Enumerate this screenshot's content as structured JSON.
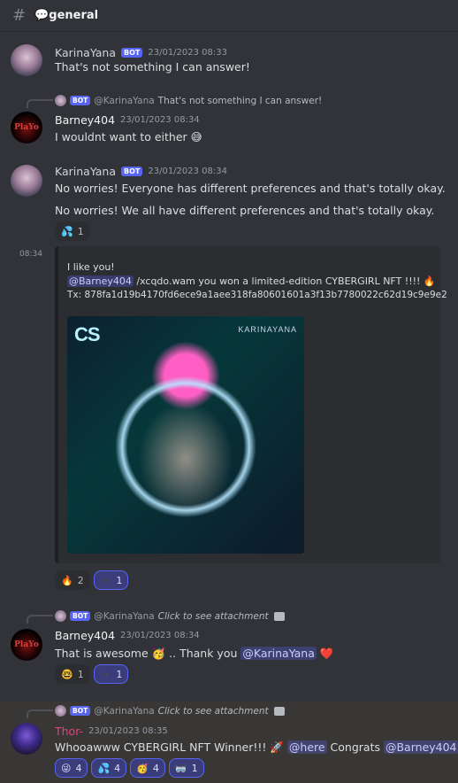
{
  "header": {
    "channel": "💬general"
  },
  "messages": {
    "m1": {
      "author": "KarinaYana",
      "bot": "BOT",
      "time": "23/01/2023 08:33",
      "text": "That's not something I can answer!"
    },
    "m2": {
      "reply": {
        "bot": "BOT",
        "who": "@KarinaYana",
        "snippet": "That's not something I can answer!"
      },
      "author": "Barney404",
      "time": "23/01/2023 08:34",
      "text": "I wouldnt want to either 😅"
    },
    "m3": {
      "author": "KarinaYana",
      "bot": "BOT",
      "time": "23/01/2023 08:34",
      "line1": "No worries! Everyone has different preferences and that's totally okay.",
      "line2": "No worries! We all have different preferences and that's totally okay.",
      "reaction": {
        "emoji": "💦",
        "count": "1"
      }
    },
    "m4": {
      "time": "08:34",
      "line1": "I like you!",
      "mention": "@Barney404",
      "line2_rest": " /xcqdo.wam you won a limited-edition CYBERGIRL NFT !!!! 🔥",
      "line3": "Tx: 878fa1d19b4170fd6ece9a1aee318fa80601601a3f13b7780022c62d19c9e9e2",
      "image_logo": "CS",
      "image_brand": "KARINAYANA",
      "reactions": [
        {
          "emoji": "🔥",
          "count": "2"
        },
        {
          "emoji": "▪️",
          "count": "1"
        }
      ]
    },
    "m5": {
      "reply": {
        "bot": "BOT",
        "who": "@KarinaYana",
        "snippet": "Click to see attachment"
      },
      "author": "Barney404",
      "time": "23/01/2023 08:34",
      "text_before": "That is awesome 🥳 .. Thank you ",
      "mention": "@KarinaYana",
      "text_after": " ❤️",
      "reactions": [
        {
          "emoji": "🤓",
          "count": "1"
        },
        {
          "emoji": "▪️",
          "count": "1"
        }
      ]
    },
    "m6": {
      "reply": {
        "bot": "BOT",
        "who": "@KarinaYana",
        "snippet": "Click to see attachment"
      },
      "author": "Thor-",
      "time": "23/01/2023 08:35",
      "text_before": "Whooawww CYBERGIRL NFT  Winner!!! 🚀 ",
      "mention1": "@here",
      "text_mid": " Congrats ",
      "mention2": "@Barney404",
      "reactions": [
        {
          "emoji": "😜",
          "count": "4"
        },
        {
          "emoji": "💦",
          "count": "4"
        },
        {
          "emoji": "🥳",
          "count": "4"
        },
        {
          "emoji": "🥽",
          "count": "1"
        }
      ]
    }
  },
  "colors": {
    "background": "#313338",
    "accent": "#5865f2",
    "thor_name": "#e5417a"
  }
}
